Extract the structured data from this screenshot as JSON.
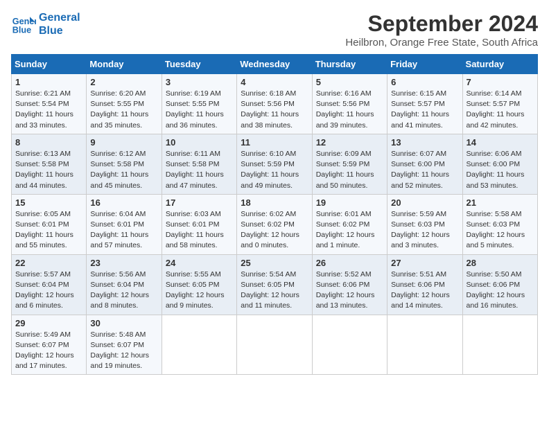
{
  "header": {
    "logo_line1": "General",
    "logo_line2": "Blue",
    "month": "September 2024",
    "location": "Heilbron, Orange Free State, South Africa"
  },
  "days_of_week": [
    "Sunday",
    "Monday",
    "Tuesday",
    "Wednesday",
    "Thursday",
    "Friday",
    "Saturday"
  ],
  "weeks": [
    [
      {
        "day": 1,
        "info": "Sunrise: 6:21 AM\nSunset: 5:54 PM\nDaylight: 11 hours\nand 33 minutes."
      },
      {
        "day": 2,
        "info": "Sunrise: 6:20 AM\nSunset: 5:55 PM\nDaylight: 11 hours\nand 35 minutes."
      },
      {
        "day": 3,
        "info": "Sunrise: 6:19 AM\nSunset: 5:55 PM\nDaylight: 11 hours\nand 36 minutes."
      },
      {
        "day": 4,
        "info": "Sunrise: 6:18 AM\nSunset: 5:56 PM\nDaylight: 11 hours\nand 38 minutes."
      },
      {
        "day": 5,
        "info": "Sunrise: 6:16 AM\nSunset: 5:56 PM\nDaylight: 11 hours\nand 39 minutes."
      },
      {
        "day": 6,
        "info": "Sunrise: 6:15 AM\nSunset: 5:57 PM\nDaylight: 11 hours\nand 41 minutes."
      },
      {
        "day": 7,
        "info": "Sunrise: 6:14 AM\nSunset: 5:57 PM\nDaylight: 11 hours\nand 42 minutes."
      }
    ],
    [
      {
        "day": 8,
        "info": "Sunrise: 6:13 AM\nSunset: 5:58 PM\nDaylight: 11 hours\nand 44 minutes."
      },
      {
        "day": 9,
        "info": "Sunrise: 6:12 AM\nSunset: 5:58 PM\nDaylight: 11 hours\nand 45 minutes."
      },
      {
        "day": 10,
        "info": "Sunrise: 6:11 AM\nSunset: 5:58 PM\nDaylight: 11 hours\nand 47 minutes."
      },
      {
        "day": 11,
        "info": "Sunrise: 6:10 AM\nSunset: 5:59 PM\nDaylight: 11 hours\nand 49 minutes."
      },
      {
        "day": 12,
        "info": "Sunrise: 6:09 AM\nSunset: 5:59 PM\nDaylight: 11 hours\nand 50 minutes."
      },
      {
        "day": 13,
        "info": "Sunrise: 6:07 AM\nSunset: 6:00 PM\nDaylight: 11 hours\nand 52 minutes."
      },
      {
        "day": 14,
        "info": "Sunrise: 6:06 AM\nSunset: 6:00 PM\nDaylight: 11 hours\nand 53 minutes."
      }
    ],
    [
      {
        "day": 15,
        "info": "Sunrise: 6:05 AM\nSunset: 6:01 PM\nDaylight: 11 hours\nand 55 minutes."
      },
      {
        "day": 16,
        "info": "Sunrise: 6:04 AM\nSunset: 6:01 PM\nDaylight: 11 hours\nand 57 minutes."
      },
      {
        "day": 17,
        "info": "Sunrise: 6:03 AM\nSunset: 6:01 PM\nDaylight: 11 hours\nand 58 minutes."
      },
      {
        "day": 18,
        "info": "Sunrise: 6:02 AM\nSunset: 6:02 PM\nDaylight: 12 hours\nand 0 minutes."
      },
      {
        "day": 19,
        "info": "Sunrise: 6:01 AM\nSunset: 6:02 PM\nDaylight: 12 hours\nand 1 minute."
      },
      {
        "day": 20,
        "info": "Sunrise: 5:59 AM\nSunset: 6:03 PM\nDaylight: 12 hours\nand 3 minutes."
      },
      {
        "day": 21,
        "info": "Sunrise: 5:58 AM\nSunset: 6:03 PM\nDaylight: 12 hours\nand 5 minutes."
      }
    ],
    [
      {
        "day": 22,
        "info": "Sunrise: 5:57 AM\nSunset: 6:04 PM\nDaylight: 12 hours\nand 6 minutes."
      },
      {
        "day": 23,
        "info": "Sunrise: 5:56 AM\nSunset: 6:04 PM\nDaylight: 12 hours\nand 8 minutes."
      },
      {
        "day": 24,
        "info": "Sunrise: 5:55 AM\nSunset: 6:05 PM\nDaylight: 12 hours\nand 9 minutes."
      },
      {
        "day": 25,
        "info": "Sunrise: 5:54 AM\nSunset: 6:05 PM\nDaylight: 12 hours\nand 11 minutes."
      },
      {
        "day": 26,
        "info": "Sunrise: 5:52 AM\nSunset: 6:06 PM\nDaylight: 12 hours\nand 13 minutes."
      },
      {
        "day": 27,
        "info": "Sunrise: 5:51 AM\nSunset: 6:06 PM\nDaylight: 12 hours\nand 14 minutes."
      },
      {
        "day": 28,
        "info": "Sunrise: 5:50 AM\nSunset: 6:06 PM\nDaylight: 12 hours\nand 16 minutes."
      }
    ],
    [
      {
        "day": 29,
        "info": "Sunrise: 5:49 AM\nSunset: 6:07 PM\nDaylight: 12 hours\nand 17 minutes."
      },
      {
        "day": 30,
        "info": "Sunrise: 5:48 AM\nSunset: 6:07 PM\nDaylight: 12 hours\nand 19 minutes."
      },
      null,
      null,
      null,
      null,
      null
    ]
  ]
}
